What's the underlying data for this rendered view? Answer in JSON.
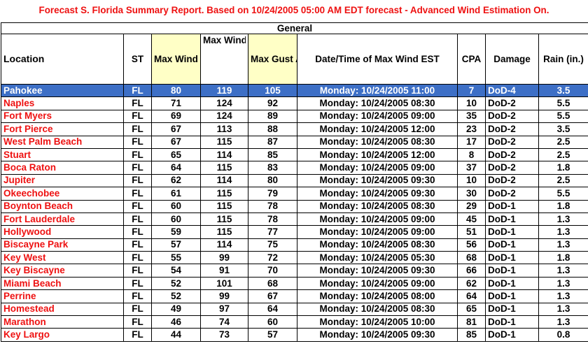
{
  "title": "Forecast S. Florida Summary Report. Based on 10/24/2005 05:00 AM EDT forecast - Advanced Wind Estimation On.",
  "section_label": "General",
  "columns": {
    "location": "Location",
    "st": "ST",
    "max_wind_awe": "Max Wind AWE (mph)",
    "max_wind_non_awe": "Max Wind Non AWE (mph)",
    "max_gust_awe": "Max Gust AWE (mph)",
    "datetime": "Date/Time of Max Wind EST",
    "cpa": "CPA",
    "damage": "Damage",
    "rain": "Rain (in.)"
  },
  "colors": {
    "title": "#ee1111",
    "location_text": "#ee1111",
    "highlight_header": "#ffffc6",
    "selected_row": "#3d6fc6"
  },
  "selected_index": 0,
  "rows": [
    {
      "location": "Pahokee",
      "st": "FL",
      "awe": "80",
      "non_awe": "119",
      "gust": "105",
      "datetime": "Monday: 10/24/2005 11:00",
      "cpa": "7",
      "damage": "DoD-4",
      "rain": "3.5"
    },
    {
      "location": "Naples",
      "st": "FL",
      "awe": "71",
      "non_awe": "124",
      "gust": "92",
      "datetime": "Monday: 10/24/2005 08:30",
      "cpa": "10",
      "damage": "DoD-2",
      "rain": "5.5"
    },
    {
      "location": "Fort Myers",
      "st": "FL",
      "awe": "69",
      "non_awe": "124",
      "gust": "89",
      "datetime": "Monday: 10/24/2005 09:00",
      "cpa": "35",
      "damage": "DoD-2",
      "rain": "5.5"
    },
    {
      "location": "Fort Pierce",
      "st": "FL",
      "awe": "67",
      "non_awe": "113",
      "gust": "88",
      "datetime": "Monday: 10/24/2005 12:00",
      "cpa": "23",
      "damage": "DoD-2",
      "rain": "3.5"
    },
    {
      "location": "West Palm Beach",
      "st": "FL",
      "awe": "67",
      "non_awe": "115",
      "gust": "87",
      "datetime": "Monday: 10/24/2005 08:30",
      "cpa": "17",
      "damage": "DoD-2",
      "rain": "2.5"
    },
    {
      "location": "Stuart",
      "st": "FL",
      "awe": "65",
      "non_awe": "114",
      "gust": "85",
      "datetime": "Monday: 10/24/2005 12:00",
      "cpa": "8",
      "damage": "DoD-2",
      "rain": "2.5"
    },
    {
      "location": "Boca Raton",
      "st": "FL",
      "awe": "64",
      "non_awe": "115",
      "gust": "83",
      "datetime": "Monday: 10/24/2005 09:00",
      "cpa": "37",
      "damage": "DoD-2",
      "rain": "1.8"
    },
    {
      "location": "Jupiter",
      "st": "FL",
      "awe": "62",
      "non_awe": "114",
      "gust": "80",
      "datetime": "Monday: 10/24/2005 09:30",
      "cpa": "10",
      "damage": "DoD-2",
      "rain": "2.5"
    },
    {
      "location": "Okeechobee",
      "st": "FL",
      "awe": "61",
      "non_awe": "115",
      "gust": "79",
      "datetime": "Monday: 10/24/2005 09:30",
      "cpa": "30",
      "damage": "DoD-2",
      "rain": "5.5"
    },
    {
      "location": "Boynton Beach",
      "st": "FL",
      "awe": "60",
      "non_awe": "115",
      "gust": "78",
      "datetime": "Monday: 10/24/2005 08:30",
      "cpa": "29",
      "damage": "DoD-1",
      "rain": "1.8"
    },
    {
      "location": "Fort Lauderdale",
      "st": "FL",
      "awe": "60",
      "non_awe": "115",
      "gust": "78",
      "datetime": "Monday: 10/24/2005 09:00",
      "cpa": "45",
      "damage": "DoD-1",
      "rain": "1.3"
    },
    {
      "location": "Hollywood",
      "st": "FL",
      "awe": "59",
      "non_awe": "115",
      "gust": "77",
      "datetime": "Monday: 10/24/2005 09:00",
      "cpa": "51",
      "damage": "DoD-1",
      "rain": "1.3"
    },
    {
      "location": "Biscayne Park",
      "st": "FL",
      "awe": "57",
      "non_awe": "114",
      "gust": "75",
      "datetime": "Monday: 10/24/2005 08:30",
      "cpa": "56",
      "damage": "DoD-1",
      "rain": "1.3"
    },
    {
      "location": "Key West",
      "st": "FL",
      "awe": "55",
      "non_awe": "99",
      "gust": "72",
      "datetime": "Monday: 10/24/2005 05:30",
      "cpa": "68",
      "damage": "DoD-1",
      "rain": "1.8"
    },
    {
      "location": "Key Biscayne",
      "st": "FL",
      "awe": "54",
      "non_awe": "91",
      "gust": "70",
      "datetime": "Monday: 10/24/2005 09:30",
      "cpa": "66",
      "damage": "DoD-1",
      "rain": "1.3"
    },
    {
      "location": "Miami Beach",
      "st": "FL",
      "awe": "52",
      "non_awe": "101",
      "gust": "68",
      "datetime": "Monday: 10/24/2005 09:00",
      "cpa": "62",
      "damage": "DoD-1",
      "rain": "1.3"
    },
    {
      "location": "Perrine",
      "st": "FL",
      "awe": "52",
      "non_awe": "99",
      "gust": "67",
      "datetime": "Monday: 10/24/2005 08:00",
      "cpa": "64",
      "damage": "DoD-1",
      "rain": "1.3"
    },
    {
      "location": "Homestead",
      "st": "FL",
      "awe": "49",
      "non_awe": "97",
      "gust": "64",
      "datetime": "Monday: 10/24/2005 08:30",
      "cpa": "65",
      "damage": "DoD-1",
      "rain": "1.3"
    },
    {
      "location": "Marathon",
      "st": "FL",
      "awe": "46",
      "non_awe": "74",
      "gust": "60",
      "datetime": "Monday: 10/24/2005 10:00",
      "cpa": "81",
      "damage": "DoD-1",
      "rain": "1.3"
    },
    {
      "location": "Key Largo",
      "st": "FL",
      "awe": "44",
      "non_awe": "73",
      "gust": "57",
      "datetime": "Monday: 10/24/2005 09:30",
      "cpa": "85",
      "damage": "DoD-1",
      "rain": "0.8"
    }
  ]
}
